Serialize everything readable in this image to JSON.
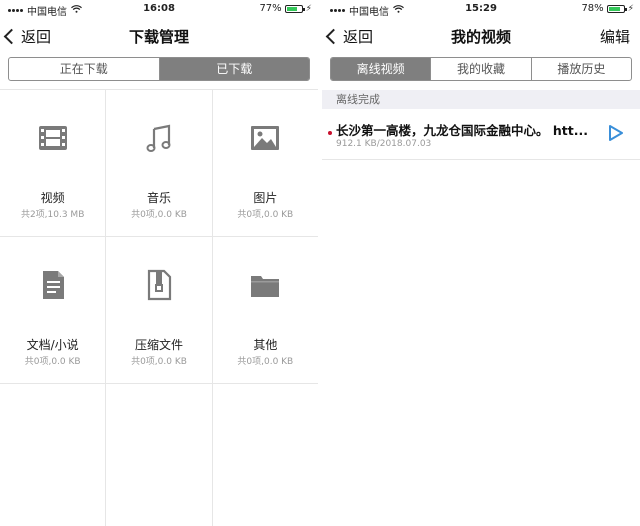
{
  "left": {
    "status": {
      "carrier": "中国电信",
      "time": "16:08",
      "battery": "77%",
      "battery_level": 0.77
    },
    "nav": {
      "back": "返回",
      "title": "下载管理"
    },
    "tabs": [
      {
        "label": "正在下载",
        "active": false
      },
      {
        "label": "已下载",
        "active": true
      }
    ],
    "grid": [
      {
        "icon": "film-icon",
        "label": "视频",
        "sub": "共2项,10.3 MB"
      },
      {
        "icon": "music-note-icon",
        "label": "音乐",
        "sub": "共0项,0.0 KB"
      },
      {
        "icon": "image-icon",
        "label": "图片",
        "sub": "共0项,0.0 KB"
      },
      {
        "icon": "document-icon",
        "label": "文档/小说",
        "sub": "共0项,0.0 KB"
      },
      {
        "icon": "archive-icon",
        "label": "压缩文件",
        "sub": "共0项,0.0 KB"
      },
      {
        "icon": "folder-icon",
        "label": "其他",
        "sub": "共0项,0.0 KB"
      }
    ]
  },
  "right": {
    "status": {
      "carrier": "中国电信",
      "time": "15:29",
      "battery": "78%",
      "battery_level": 0.78
    },
    "nav": {
      "back": "返回",
      "title": "我的视频",
      "edit": "编辑"
    },
    "tabs": [
      {
        "label": "离线视频",
        "active": true
      },
      {
        "label": "我的收藏",
        "active": false
      },
      {
        "label": "播放历史",
        "active": false
      }
    ],
    "section": "离线完成",
    "items": [
      {
        "title": "长沙第一高楼，九龙仓国际金融中心。 htt...",
        "meta": "912.1 KB/2018.07.03"
      }
    ]
  },
  "colors": {
    "tab_active": "#7f7f7f",
    "battery": "#34c759",
    "play": "#3a8fd9",
    "unread_dot": "#c8102e",
    "icon": "#7a7a7a"
  }
}
